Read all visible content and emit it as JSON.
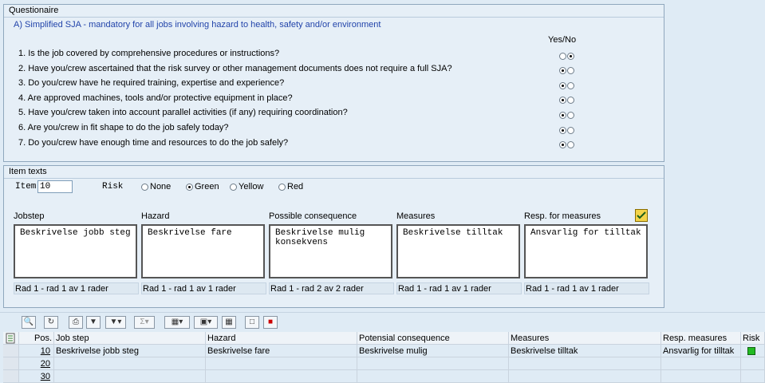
{
  "questionaire": {
    "title": "Questionaire",
    "section_heading": "A) Simplified SJA - mandatory for all jobs involving hazard to health, safety and/or environment",
    "yes_no_header": "Yes/No",
    "questions": [
      {
        "text": "1. Is the job covered by comprehensive procedures or instructions?",
        "answer": "No"
      },
      {
        "text": "2. Have you/crew ascertained that the risk survey or other management documents does not require a full SJA?",
        "answer": "Yes"
      },
      {
        "text": "3. Do you/crew have he required training, expertise and experience?",
        "answer": "Yes"
      },
      {
        "text": "4. Are approved machines, tools and/or protective equipment in place?",
        "answer": "Yes"
      },
      {
        "text": "5. Have you/crew taken into account parallel activities (if any) requiring coordination?",
        "answer": "Yes"
      },
      {
        "text": "6. Are you/crew in fit shape to do the job safely today?",
        "answer": "Yes"
      },
      {
        "text": "7. Do you/crew have enough time and resources to do the job safely?",
        "answer": "Yes"
      }
    ]
  },
  "item_texts": {
    "title": "Item texts",
    "item_label": "Item",
    "item_value": "10",
    "risk_label": "Risk",
    "risk_options": [
      "None",
      "Green",
      "Yellow",
      "Red"
    ],
    "risk_selected": "Green",
    "columns": [
      {
        "header": "Jobstep",
        "text": "Beskrivelse jobb steg",
        "status": "Rad 1 - rad 1 av 1 rader"
      },
      {
        "header": "Hazard",
        "text": "Beskrivelse fare",
        "status": "Rad 1 - rad 1 av 1 rader"
      },
      {
        "header": "Possible consequence",
        "text": "Beskrivelse mulig\nkonsekvens",
        "status": "Rad 1 - rad 2 av 2 rader"
      },
      {
        "header": "Measures",
        "text": "Beskrivelse tilltak",
        "status": "Rad 1 - rad 1 av 1 rader"
      },
      {
        "header": "Resp. for measures",
        "text": "Ansvarlig for tilltak",
        "status": "Rad 1 - rad 1 av 1 rader"
      }
    ]
  },
  "toolbar": {
    "icons": [
      "details-icon",
      "refresh-icon",
      "print-icon",
      "filter-icon",
      "set-filter-icon",
      "sum-icon",
      "export-icon",
      "layout-icon",
      "grid-icon",
      "new-doc-icon",
      "delete-icon"
    ]
  },
  "grid": {
    "headers": [
      "Pos.",
      "Job step",
      "Hazard",
      "Potensial consequence",
      "Measures",
      "Resp. measures",
      "Risk"
    ],
    "rows": [
      {
        "pos": "10",
        "job_step": "Beskrivelse jobb steg",
        "hazard": "Beskrivelse fare",
        "consequence": "Beskrivelse mulig",
        "measures": "Beskrivelse tilltak",
        "resp": "Ansvarlig for tilltak",
        "risk": "green"
      },
      {
        "pos": "20",
        "job_step": "",
        "hazard": "",
        "consequence": "",
        "measures": "",
        "resp": "",
        "risk": ""
      },
      {
        "pos": "30",
        "job_step": "",
        "hazard": "",
        "consequence": "",
        "measures": "",
        "resp": "",
        "risk": ""
      }
    ]
  }
}
